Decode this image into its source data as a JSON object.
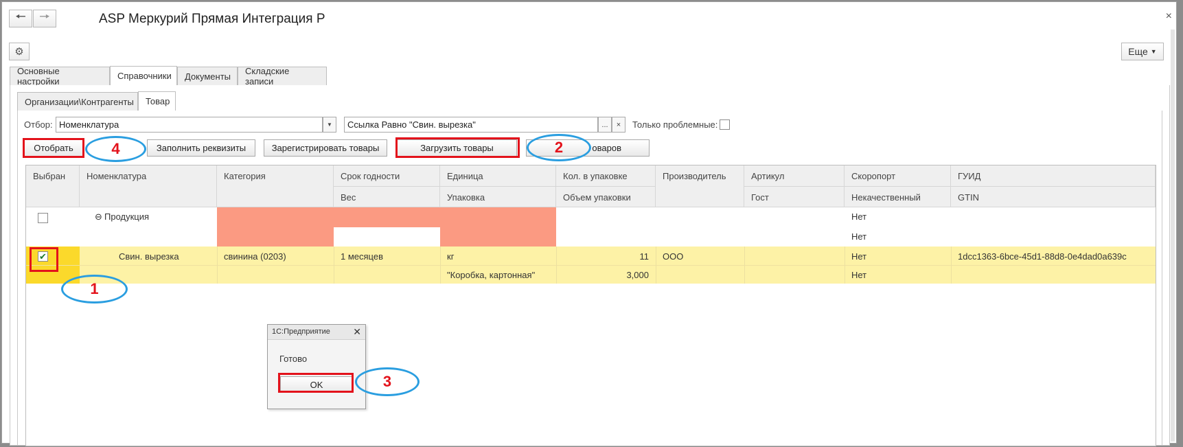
{
  "window": {
    "title": "ASP Меркурий Прямая Интеграция Р",
    "back_icon": "arrow-left-icon",
    "forward_icon": "arrow-right-icon",
    "close_label": "×",
    "more_label": "Еще"
  },
  "tabs": [
    "Основные настройки",
    "Справочники",
    "Документы",
    "Складские записи"
  ],
  "subtabs": [
    "Организации\\Контрагенты",
    "Товар"
  ],
  "filter": {
    "label": "Отбор:",
    "field_value": "Номенклатура",
    "condition_value": "Ссылка Равно \"Свин. вырезка\"",
    "ellipsis": "...",
    "clear": "×",
    "only_problem_label": "Только проблемные:"
  },
  "toolbar": {
    "select": "Отобрать",
    "fill": "Заполнить реквизиты",
    "register": "Зарегистрировать товары",
    "load": "Загрузить товары",
    "hidden_partial": "оваров"
  },
  "grid": {
    "headers_row1": [
      "Выбран",
      "Номенклатура",
      "Категория",
      "Срок годности",
      "Единица",
      "Кол. в упаковке",
      "Производитель",
      "Артикул",
      "Скоропорт",
      "ГУИД"
    ],
    "headers_row2": [
      "Вес",
      "Упаковка",
      "Объем упаковки",
      "Гост",
      "Некачественный",
      "GTIN"
    ],
    "group_row": {
      "expand": "⊖",
      "name": "Продукция",
      "perishable": "Нет",
      "defective": "Нет"
    },
    "item_row": {
      "name": "Свин. вырезка",
      "category": "свинина (0203)",
      "shelf_life": "1 месяцев",
      "unit": "кг",
      "qty_in_pack": "11",
      "producer": "ООО",
      "perishable": "Нет",
      "guid": "1dcc1363-6bce-45d1-88d8-0e4dad0a639c",
      "package": "\"Коробка, картонная\"",
      "pack_volume": "3,000",
      "defective": "Нет"
    }
  },
  "dialog": {
    "title": "1С:Предприятие",
    "close": "✕",
    "message": "Готово",
    "ok": "OK"
  },
  "annotations": [
    "1",
    "2",
    "3",
    "4"
  ],
  "colors": {
    "highlight_row": "#fdf2a6",
    "checkbox_cell": "#fbd92b",
    "salmon": "#fb9a82",
    "red_box": "#e3121b",
    "blue_oval": "#2a9ee0"
  }
}
